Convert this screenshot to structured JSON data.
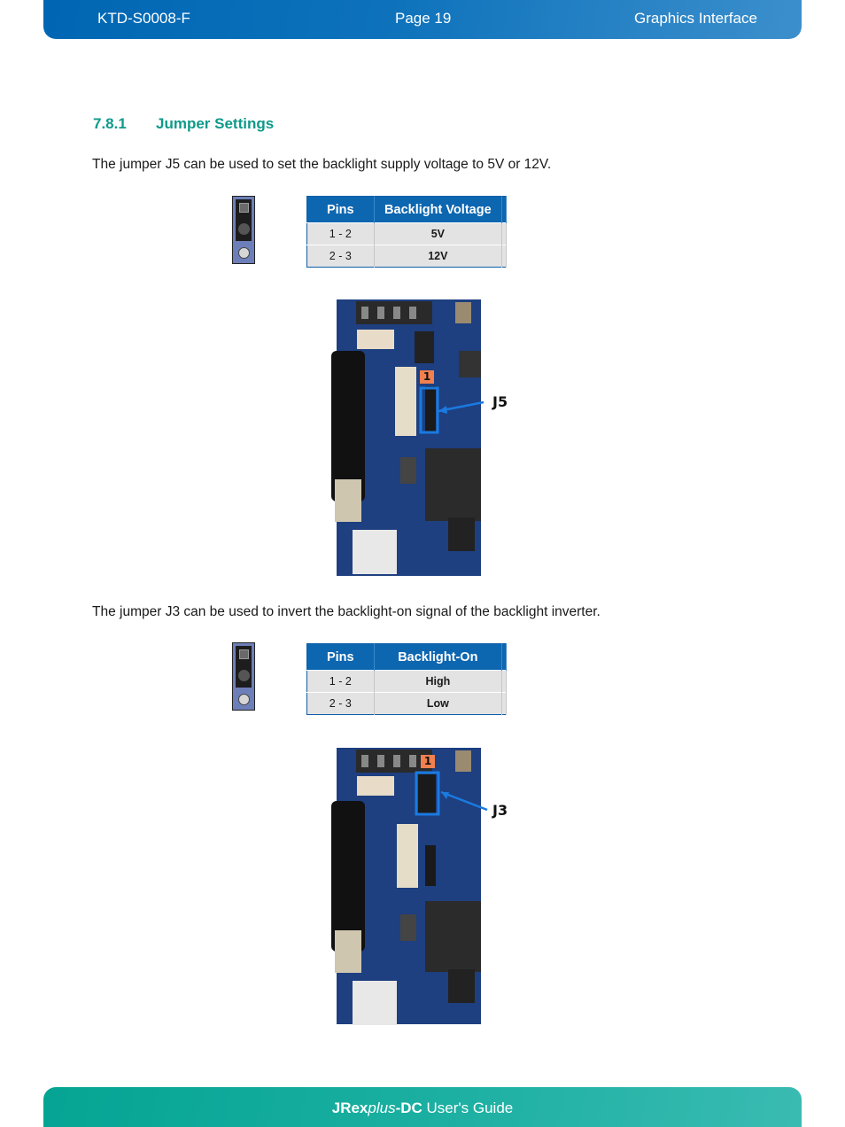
{
  "header": {
    "doc_id": "KTD-S0008-F",
    "page": "Page 19",
    "chapter": "Graphics Interface"
  },
  "section": {
    "number": "7.8.1",
    "title": "Jumper Settings"
  },
  "j5": {
    "description": "The jumper J5 can be used to set the backlight supply voltage to 5V or 12V.",
    "table": {
      "headers": [
        "Pins",
        "Backlight Voltage"
      ],
      "rows": [
        {
          "pins": "1 - 2",
          "value": "5V"
        },
        {
          "pins": "2 - 3",
          "value": "12V"
        }
      ]
    },
    "photo": {
      "pin1_marker": "1",
      "label": "J5"
    }
  },
  "j3": {
    "description": "The jumper J3 can be used to invert the backlight-on signal of the backlight inverter.",
    "table": {
      "headers": [
        "Pins",
        "Backlight-On"
      ],
      "rows": [
        {
          "pins": "1 - 2",
          "value": "High"
        },
        {
          "pins": "2 - 3",
          "value": "Low"
        }
      ]
    },
    "photo": {
      "pin1_marker": "1",
      "label": "J3"
    }
  },
  "footer": {
    "product_bold_1": "JRex",
    "product_italic": "plus",
    "product_bold_2": "-DC",
    "suffix": " User's Guide"
  },
  "colors": {
    "header_blue": "#0066b3",
    "footer_teal": "#04a493",
    "section_title": "#0e9a8a",
    "table_header": "#0d66b0",
    "pin1_marker": "#f0804f",
    "highlight_box": "#1a7ae0"
  }
}
